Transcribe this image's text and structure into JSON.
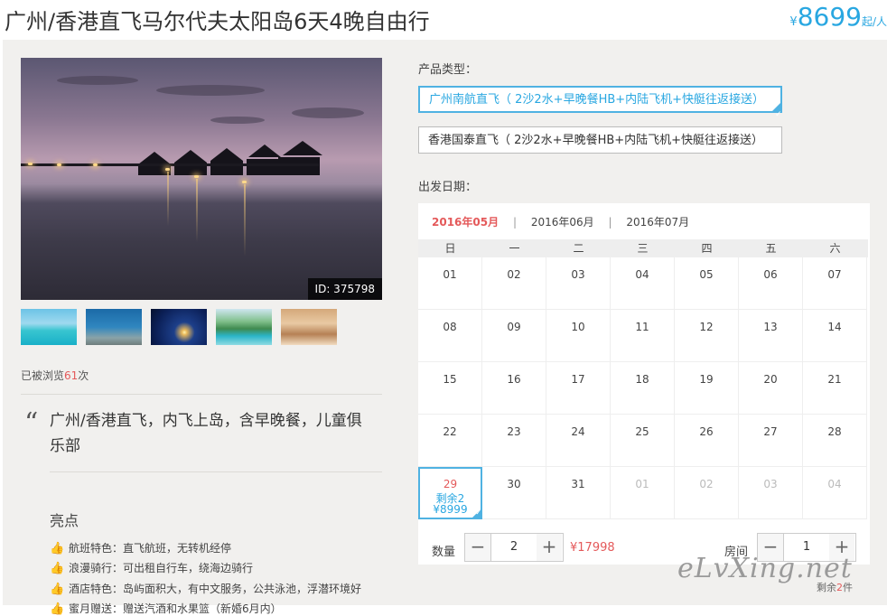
{
  "header": {
    "title": "广州/香港直飞马尔代夫太阳岛6天4晚自由行",
    "price_symbol": "¥",
    "price_value": "8699",
    "price_unit": "起/人"
  },
  "gallery": {
    "photo_id_label": "ID: 375798",
    "thumbnails": [
      "thumb-1",
      "thumb-2",
      "thumb-3",
      "thumb-4",
      "thumb-5"
    ]
  },
  "views": {
    "prefix": "已被浏览",
    "count": "61",
    "suffix": "次"
  },
  "summary": {
    "quote_mark": "“",
    "text": "广州/香港直飞，内飞上岛，含早晚餐，儿童俱乐部"
  },
  "highlights": {
    "title": "亮点",
    "items": [
      "航班特色：直飞航班，无转机经停",
      "浪漫骑行：可出租自行车，绕海边骑行",
      "酒店特色：岛屿面积大，有中文服务，公共泳池，浮潜环境好",
      "蜜月赠送：赠送汽酒和水果篮（新婚6月内）"
    ]
  },
  "product_type": {
    "label": "产品类型：",
    "options": [
      {
        "text": "广州南航直飞（ 2沙2水+早晚餐HB+内陆飞机+快艇往返接送）",
        "selected": true
      },
      {
        "text": "香港国泰直飞（ 2沙2水+早晚餐HB+内陆飞机+快艇往返接送）",
        "selected": false
      }
    ]
  },
  "departure": {
    "label": "出发日期：",
    "months": [
      "2016年05月",
      "2016年06月",
      "2016年07月"
    ],
    "active_month": "2016年05月",
    "separator": "|",
    "weekdays": [
      "日",
      "一",
      "二",
      "三",
      "四",
      "五",
      "六"
    ],
    "days": [
      {
        "d": "01"
      },
      {
        "d": "02"
      },
      {
        "d": "03"
      },
      {
        "d": "04"
      },
      {
        "d": "05"
      },
      {
        "d": "06"
      },
      {
        "d": "07"
      },
      {
        "d": "08"
      },
      {
        "d": "09"
      },
      {
        "d": "10"
      },
      {
        "d": "11"
      },
      {
        "d": "12"
      },
      {
        "d": "13"
      },
      {
        "d": "14"
      },
      {
        "d": "15"
      },
      {
        "d": "16"
      },
      {
        "d": "17"
      },
      {
        "d": "18"
      },
      {
        "d": "19"
      },
      {
        "d": "20"
      },
      {
        "d": "21"
      },
      {
        "d": "22"
      },
      {
        "d": "23"
      },
      {
        "d": "24"
      },
      {
        "d": "25"
      },
      {
        "d": "26"
      },
      {
        "d": "27"
      },
      {
        "d": "28"
      },
      {
        "d": "29",
        "remain": "剩余2",
        "price": "¥8999",
        "available": true
      },
      {
        "d": "30"
      },
      {
        "d": "31"
      },
      {
        "d": "01",
        "other": true
      },
      {
        "d": "02",
        "other": true
      },
      {
        "d": "03",
        "other": true
      },
      {
        "d": "04",
        "other": true
      }
    ]
  },
  "booking": {
    "quantity_label": "数量",
    "quantity": "2",
    "minus": "−",
    "plus": "+",
    "total": "¥17998",
    "room_label": "房间",
    "rooms": "1",
    "remain_prefix": "剩余",
    "remain_count": "2",
    "remain_suffix": "件"
  },
  "watermark": "eLvXing.net",
  "colors": {
    "accent": "#29a7e1",
    "price_red": "#e4595a",
    "panel_bg": "#f1f0ee",
    "highlight_icon": "#f08b22"
  }
}
